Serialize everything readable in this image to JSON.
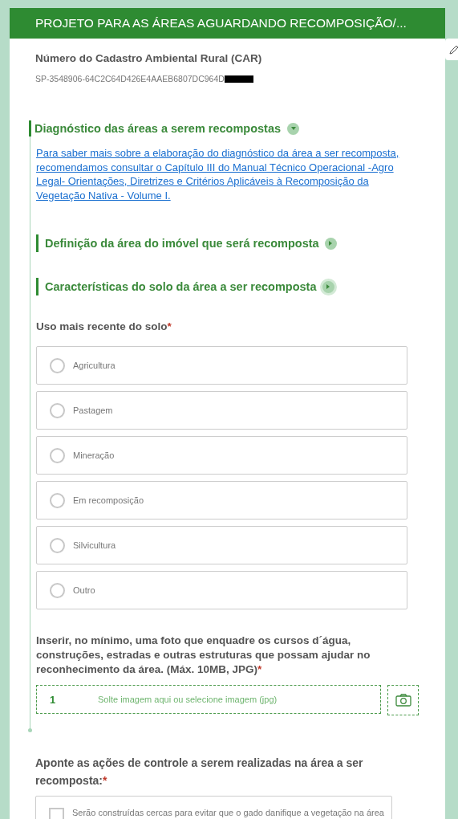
{
  "header": {
    "title": "PROJETO PARA AS ÁREAS AGUARDANDO RECOMPOSIÇÃO/..."
  },
  "car": {
    "label": "Número do Cadastro Ambiental Rural (CAR)",
    "value": "SP-3548906-64C2C64D426E4AAEB6807DC964D"
  },
  "group": {
    "title": "Diagnóstico das áreas a serem recompostas",
    "expanded": true,
    "link": " Para saber mais sobre a elaboração do diagnóstico da área a ser recomposta, recomendamos consultar o Capítulo III do Manual Técnico Operacional -Agro Legal- Orientações, Diretrizes e Critérios Aplicáveis à Recomposição da Vegetação Nativa - Volume I.",
    "subsections": [
      {
        "title": "Definição da área do imóvel que será recomposta",
        "expanded": false
      },
      {
        "title": "Características do solo da área a ser recomposta",
        "expanded": false
      }
    ],
    "soil_use": {
      "label": "Uso mais recente do solo",
      "required": "*",
      "options": [
        {
          "label": "Agricultura",
          "selected": false
        },
        {
          "label": "Pastagem",
          "selected": false
        },
        {
          "label": "Mineração",
          "selected": false
        },
        {
          "label": "Em recomposição",
          "selected": false
        },
        {
          "label": "Silvicultura",
          "selected": false
        },
        {
          "label": "Outro",
          "selected": false
        }
      ]
    },
    "photo": {
      "label": "Inserir, no mínimo, uma foto que enquadre os cursos d´água, construções, estradas e outras estruturas que possam ajudar no reconhecimento da área. (Máx. 10MB, JPG)",
      "required": "*",
      "count": "1",
      "placeholder": "Solte imagem aqui ou selecione imagem (jpg)"
    }
  },
  "actions": {
    "label": "Aponte as ações de controle a serem realizadas na área a ser recomposta:",
    "required": "*",
    "options": [
      {
        "label": "Serão construídas cercas para evitar que o gado danifique a vegetação na área",
        "checked": false
      }
    ]
  }
}
